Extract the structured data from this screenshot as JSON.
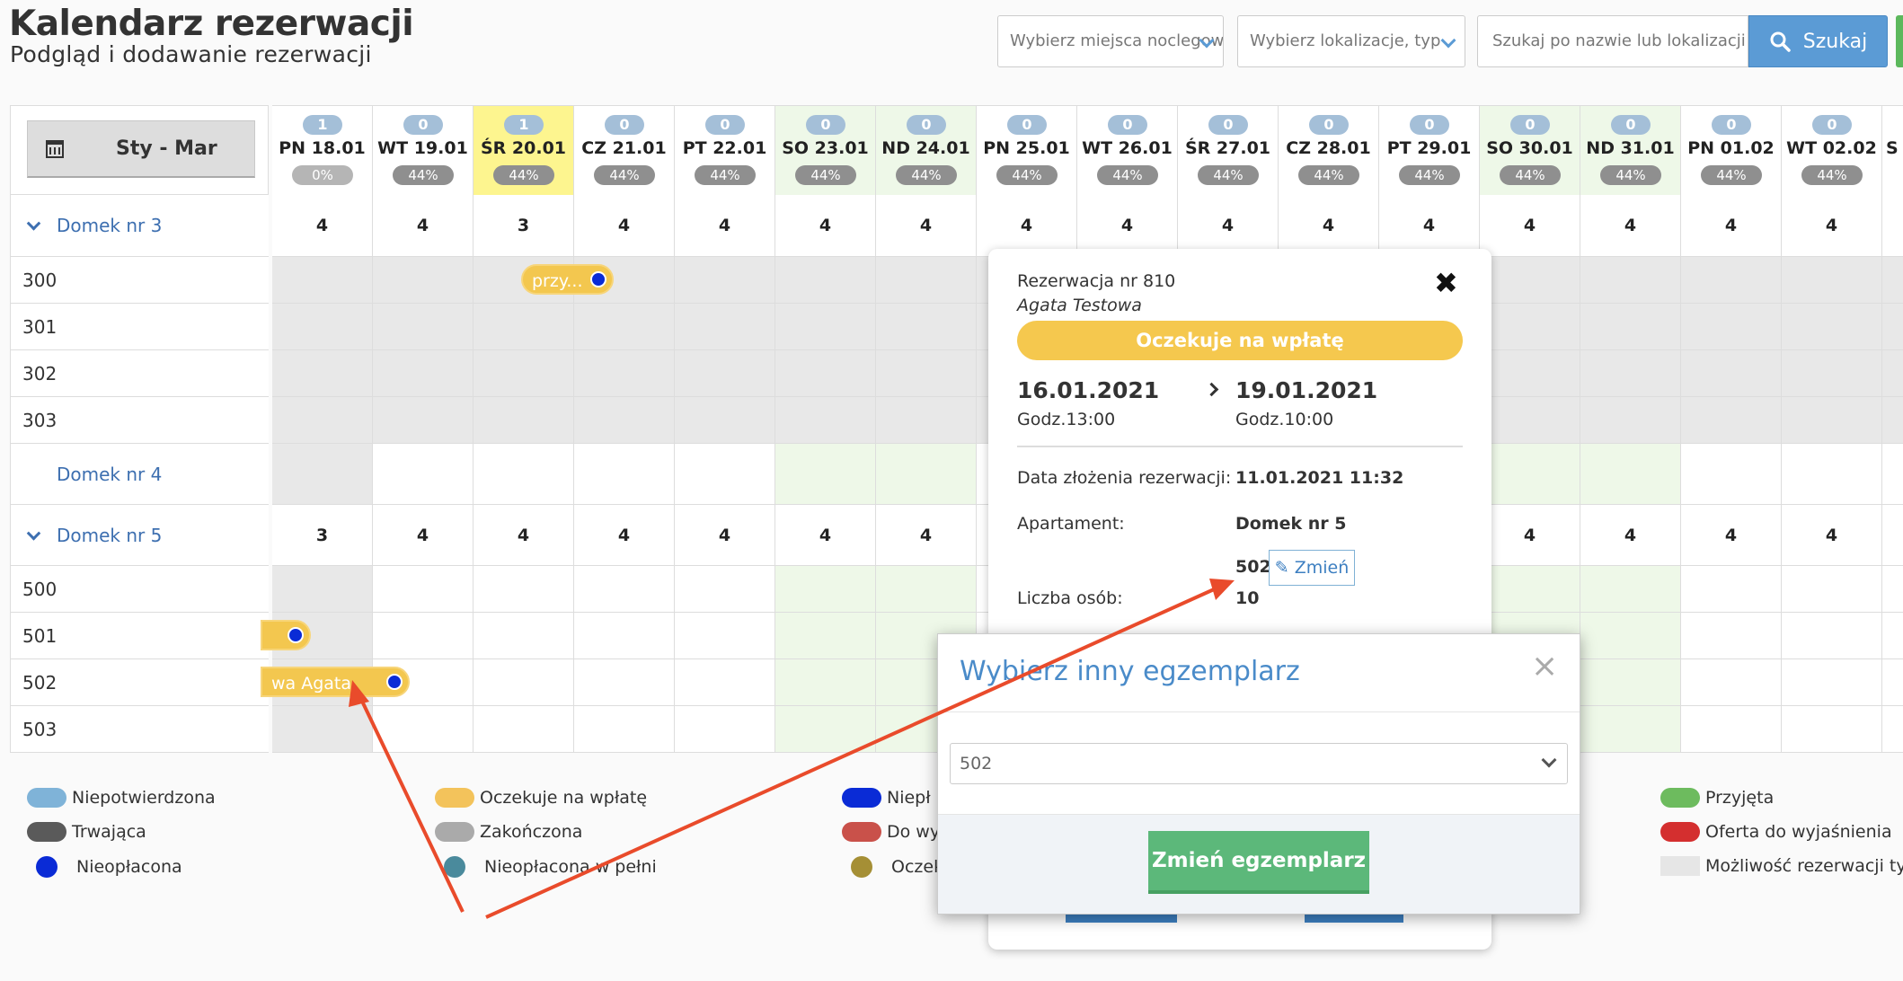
{
  "header": {
    "title": "Kalendarz rezerwacji",
    "subtitle": "Podgląd i dodawanie rezerwacji",
    "select_places": "Wybierz miejsca noclegowe",
    "select_location": "Wybierz lokalizacje, typ",
    "search_placeholder": "Szukaj po nazwie lub lokalizacji",
    "search_button": "Szukaj",
    "search_icon": "search-icon",
    "dropdown_icon": "chevron-down-icon"
  },
  "calendar": {
    "range_label": "Sty - Mar",
    "range_icon": "calendar-icon",
    "days": [
      {
        "label": "PN 18.01",
        "count": "1",
        "pct": "0%",
        "weekend": false,
        "today": false
      },
      {
        "label": "WT 19.01",
        "count": "0",
        "pct": "44%",
        "weekend": false,
        "today": false
      },
      {
        "label": "ŚR 20.01",
        "count": "1",
        "pct": "44%",
        "weekend": false,
        "today": true
      },
      {
        "label": "CZ 21.01",
        "count": "0",
        "pct": "44%",
        "weekend": false,
        "today": false
      },
      {
        "label": "PT 22.01",
        "count": "0",
        "pct": "44%",
        "weekend": false,
        "today": false
      },
      {
        "label": "SO 23.01",
        "count": "0",
        "pct": "44%",
        "weekend": true,
        "today": false
      },
      {
        "label": "ND 24.01",
        "count": "0",
        "pct": "44%",
        "weekend": true,
        "today": false
      },
      {
        "label": "PN 25.01",
        "count": "0",
        "pct": "44%",
        "weekend": false,
        "today": false
      },
      {
        "label": "WT 26.01",
        "count": "0",
        "pct": "44%",
        "weekend": false,
        "today": false
      },
      {
        "label": "ŚR 27.01",
        "count": "0",
        "pct": "44%",
        "weekend": false,
        "today": false
      },
      {
        "label": "CZ 28.01",
        "count": "0",
        "pct": "44%",
        "weekend": false,
        "today": false
      },
      {
        "label": "PT 29.01",
        "count": "0",
        "pct": "44%",
        "weekend": false,
        "today": false
      },
      {
        "label": "SO 30.01",
        "count": "0",
        "pct": "44%",
        "weekend": true,
        "today": false
      },
      {
        "label": "ND 31.01",
        "count": "0",
        "pct": "44%",
        "weekend": true,
        "today": false
      },
      {
        "label": "PN 01.02",
        "count": "0",
        "pct": "44%",
        "weekend": false,
        "today": false
      },
      {
        "label": "WT 02.02",
        "count": "0",
        "pct": "44%",
        "weekend": false,
        "today": false
      },
      {
        "label": "S",
        "count": "",
        "pct": "",
        "weekend": false,
        "today": false
      }
    ],
    "rows": [
      {
        "label": "Domek nr 3",
        "type": "group",
        "expand": true,
        "counts": [
          "4",
          "4",
          "3",
          "4",
          "4",
          "4",
          "4",
          "4",
          "4",
          "4",
          "4",
          "4",
          "4",
          "4",
          "4",
          "4"
        ]
      },
      {
        "label": "300",
        "type": "unit"
      },
      {
        "label": "301",
        "type": "unit"
      },
      {
        "label": "302",
        "type": "unit"
      },
      {
        "label": "303",
        "type": "unit"
      },
      {
        "label": "Domek nr 4",
        "type": "group",
        "expand": false,
        "counts": []
      },
      {
        "label": "Domek nr 5",
        "type": "group",
        "expand": true,
        "counts": [
          "3",
          "4",
          "4",
          "4",
          "4",
          "4",
          "4",
          "",
          "",
          "",
          "",
          "",
          "4",
          "4",
          "4",
          "4"
        ]
      },
      {
        "label": "500",
        "type": "unit"
      },
      {
        "label": "501",
        "type": "unit"
      },
      {
        "label": "502",
        "type": "unit"
      },
      {
        "label": "503",
        "type": "unit"
      }
    ],
    "reservations": [
      {
        "text": "przy...",
        "color": "#f3c74f",
        "dot": "#0a2bd6"
      },
      {
        "text": "...",
        "color": "#f3c74f",
        "dot": "#0a2bd6"
      },
      {
        "text": "wa Agata",
        "color": "#f3c74f",
        "dot": "#0a2bd6"
      }
    ]
  },
  "legend": [
    {
      "label": "Niepotwierdzona",
      "kind": "pill",
      "color": "#7fb3d8"
    },
    {
      "label": "Oczekuje na wpłatę",
      "kind": "pill",
      "color": "#f3c35b"
    },
    {
      "label": "Niepł",
      "kind": "pill",
      "color": "#0a2bd6"
    },
    {
      "label": "Przyjęta",
      "kind": "pill",
      "color": "#6dbb5e"
    },
    {
      "label": "Trwająca",
      "kind": "pill",
      "color": "#5a5a5a"
    },
    {
      "label": "Zakończona",
      "kind": "pill",
      "color": "#aaaaaa"
    },
    {
      "label": "Do wyj",
      "kind": "pill",
      "color": "#c9514a"
    },
    {
      "label": "Oferta do wyjaśnienia",
      "kind": "pill",
      "color": "#d42f2f"
    },
    {
      "label": "Nieopłacona",
      "kind": "dot",
      "color": "#0a2bd6"
    },
    {
      "label": "Nieopłacona w pełni",
      "kind": "dot",
      "color": "#4a8a9c"
    },
    {
      "label": "Oczek",
      "kind": "dot",
      "color": "#a58f35"
    },
    {
      "label": "Możliwość rezerwacji tylk",
      "kind": "square",
      "color": "#e6e6e6"
    }
  ],
  "popup": {
    "number": "Rezerwacja nr 810",
    "name": "Agata Testowa",
    "status": "Oczekuje na wpłatę",
    "status_color": "#f5c84e",
    "date_from": "16.01.2021",
    "time_from": "Godz.13:00",
    "date_to": "19.01.2021",
    "time_to": "Godz.10:00",
    "submitted_label": "Data złożenia rezerwacji:",
    "submitted_value": "11.01.2021 11:32",
    "apartment_label": "Apartament:",
    "apartment_value": "Domek nr 5",
    "unit_value": "502",
    "change_label": "Zmień",
    "persons_label": "Liczba osób:",
    "persons_value": "10",
    "close_icon": "close-icon",
    "edit_icon": "pencil-icon"
  },
  "modal": {
    "title": "Wybierz inny egzemplarz",
    "selected": "502",
    "button": "Zmień egzemplarz",
    "close_icon": "close-icon"
  }
}
